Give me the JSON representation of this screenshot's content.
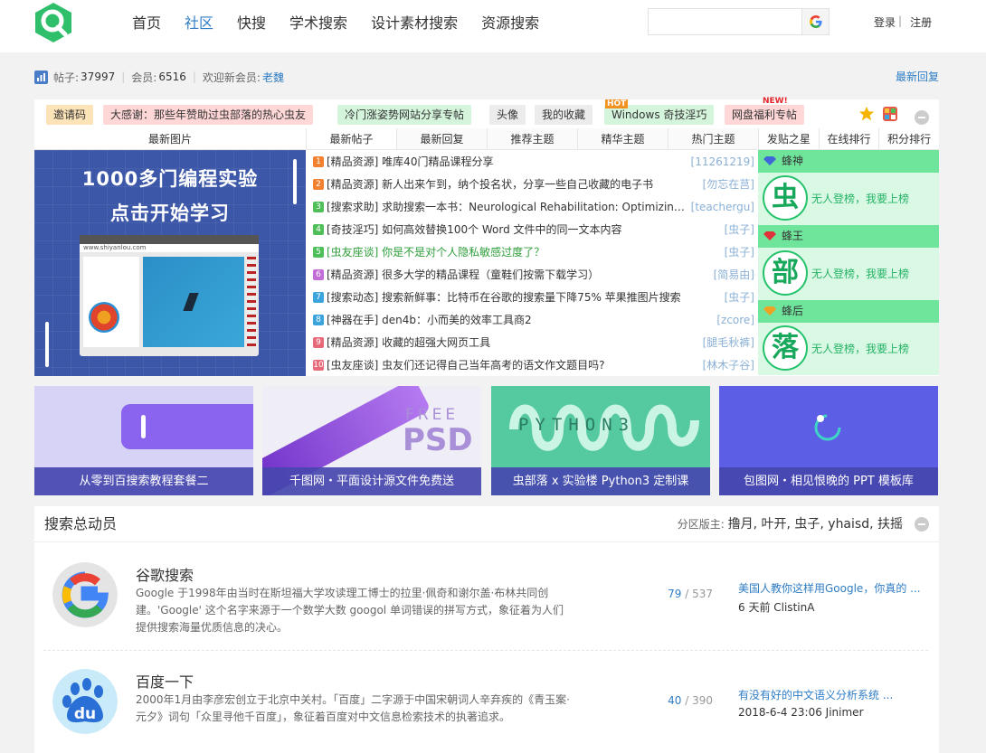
{
  "header": {
    "nav": [
      "首页",
      "社区",
      "快搜",
      "学术搜索",
      "设计素材搜索",
      "资源搜索"
    ],
    "active_nav": "社区",
    "search_placeholder": "",
    "login": "登录",
    "auth_sep": "|",
    "register": "注册"
  },
  "stats": {
    "posts_label": "帖子:",
    "posts": "37997",
    "members_label": "会员:",
    "members": "6516",
    "welcome_label": "欢迎新会员:",
    "new_member": "老魏",
    "latest_reply": "最新回复"
  },
  "quicklinks": [
    {
      "label": "邀请码",
      "bg": "#fde4b8"
    },
    {
      "label": "大感谢：那些年赞助过虫部落的热心虫友",
      "bg": "#ffd7d7"
    },
    {
      "label": "冷门涨姿势网站分享专帖",
      "bg": "#d4f5dc"
    },
    {
      "label": "头像",
      "bg": "#ececec"
    },
    {
      "label": "我的收藏",
      "bg": "#ececec"
    },
    {
      "label": "Windows 奇技淫巧",
      "bg": "#d4f5dc"
    },
    {
      "label": "网盘福利专帖",
      "bg": "#ffd7d7"
    }
  ],
  "badges": {
    "hot": "HOT",
    "new": "NEW!"
  },
  "image_panel": {
    "title": "最新图片",
    "banner_line1": "1000多门编程实验",
    "banner_line2": "点击开始学习",
    "banner_url": "www.shiyanlou.com"
  },
  "post_tabs": [
    "最新帖子",
    "最新回复",
    "推荐主题",
    "精华主题",
    "热门主题"
  ],
  "posts": [
    {
      "n": "1",
      "title": "[精品资源] 唯库40门精品课程分享",
      "author": "[11261219]",
      "color": "#f2802e",
      "title_color": "#333333"
    },
    {
      "n": "2",
      "title": "[精品资源] 新人出来乍到，纳个投名状，分享一些自己收藏的电子书",
      "author": "[勿忘在莒]",
      "color": "#f2802e",
      "title_color": "#333333"
    },
    {
      "n": "3",
      "title": "[搜索求助] 求助搜索一本书：Neurological Rehabilitation: Optimizing moto",
      "author": "[teachergu]",
      "color": "#4fbf5a",
      "title_color": "#333333"
    },
    {
      "n": "4",
      "title": "[奇技淫巧] 如何高效替换100个 Word 文件中的同一文本内容",
      "author": "[虫子]",
      "color": "#4fbf5a",
      "title_color": "#333333"
    },
    {
      "n": "5",
      "title": "[虫友座谈] 你是不是对个人隐私敏感过度了？",
      "author": "[虫子]",
      "color": "#4fbf5a",
      "title_color": "#2e9e3a"
    },
    {
      "n": "6",
      "title": "[精品资源] 很多大学的精品课程（童鞋们按需下载学习）",
      "author": "[简易由]",
      "color": "#c36bd6",
      "title_color": "#333333"
    },
    {
      "n": "7",
      "title": "[搜索动态] 搜索新鲜事：比特币在谷歌的搜索量下降75% 苹果推图片搜索",
      "author": "[虫子]",
      "color": "#3ba4dd",
      "title_color": "#333333"
    },
    {
      "n": "8",
      "title": "[神器在手] den4b：小而美的效率工具商2",
      "author": "[zcore]",
      "color": "#3ba4dd",
      "title_color": "#333333"
    },
    {
      "n": "9",
      "title": "[精品资源] 收藏的超强大网页工具",
      "author": "[腿毛秋裤]",
      "color": "#e86a7a",
      "title_color": "#333333"
    },
    {
      "n": "10",
      "title": "[虫友座谈] 虫友们还记得自己当年高考的语文作文题目吗?",
      "author": "[林木子谷]",
      "color": "#e86a7a",
      "title_color": "#333333"
    }
  ],
  "star_tabs": [
    "发贴之星",
    "在线排行",
    "积分排行"
  ],
  "ranks": [
    {
      "rank": "蜂神",
      "char": "虫",
      "msg": "无人登榜，我要上榜",
      "gem": "#3f66d8"
    },
    {
      "rank": "蜂王",
      "char": "部",
      "msg": "无人登榜，我要上榜",
      "gem": "#e0323a"
    },
    {
      "rank": "蜂后",
      "char": "落",
      "msg": "无人登榜，我要上榜",
      "gem": "#f0a323"
    }
  ],
  "promo_cards": [
    {
      "caption": "从零到百搜索教程套餐二"
    },
    {
      "caption": "千图网・平面设计源文件免费送",
      "free": "FREE",
      "psd": "PSD"
    },
    {
      "caption": "虫部落 x 实验楼 Python3 定制课",
      "py": "PYTHON3"
    },
    {
      "caption": "包图网・相见恨晚的 PPT 模板库"
    }
  ],
  "forum": {
    "title": "搜索总动员",
    "mods_label": "分区版主:",
    "mods": "撸月, 叶开, 虫子, yhaisd, 扶摇",
    "boards": [
      {
        "name": "谷歌搜索",
        "desc": "Google 于1998年由当时在斯坦福大学攻读理工博士的拉里·佩奇和谢尔盖·布林共同创建。'Google' 这个名字来源于一个数学大数 googol 单词错误的拼写方式，象征着为人们提供搜索海量优质信息的决心。",
        "threads": "79",
        "slash": " / ",
        "posts": "537",
        "last_title": "美国人教你这样用Google，你真的 ...",
        "last_meta": "6 天前 ClistinA"
      },
      {
        "name": "百度一下",
        "desc": "2000年1月由李彦宏创立于北京中关村。「百度」二字源于中国宋朝词人辛弃疾的《青玉案·元夕》词句「众里寻他千百度」，象征着百度对中文信息检索技术的执著追求。",
        "threads": "40",
        "slash": " / ",
        "posts": "390",
        "last_title": "有没有好的中文语义分析系统 ...",
        "last_meta": "2018-6-4 23:06 Jinimer"
      }
    ]
  }
}
